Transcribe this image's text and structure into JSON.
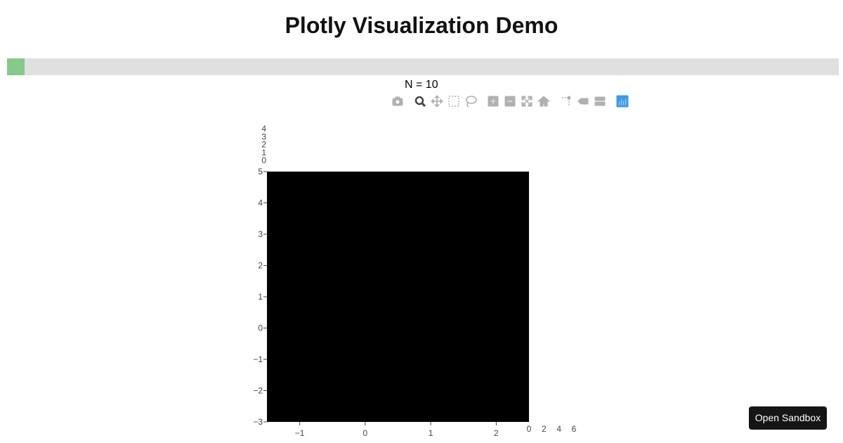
{
  "page": {
    "title": "Plotly Visualization Demo"
  },
  "progress": {
    "fraction": 0.021,
    "color": "#86c988"
  },
  "plot": {
    "n_label": "N = 10"
  },
  "modebar": {
    "buttons": [
      {
        "icon": "camera-icon",
        "active": false
      },
      {
        "icon": "zoom-icon",
        "active": true
      },
      {
        "icon": "pan-icon",
        "active": false
      },
      {
        "icon": "box-select-icon",
        "active": false
      },
      {
        "icon": "lasso-select-icon",
        "active": false
      },
      {
        "icon": "zoom-in-icon",
        "active": false
      },
      {
        "icon": "zoom-out-icon",
        "active": false
      },
      {
        "icon": "autoscale-icon",
        "active": false
      },
      {
        "icon": "reset-axes-icon",
        "active": false
      },
      {
        "icon": "spike-lines-icon",
        "active": false
      },
      {
        "icon": "hover-closest-icon",
        "active": false
      },
      {
        "icon": "hover-compare-icon",
        "active": false
      },
      {
        "icon": "plotly-logo-icon",
        "active": false
      }
    ],
    "colors": {
      "inactive": "#b0b0b0",
      "active": "#444444",
      "logo": "#3d9be9"
    }
  },
  "chart_data": {
    "type": "heatmap",
    "main": {
      "xlim": [
        -1.5,
        2.5
      ],
      "ylim": [
        -3,
        5
      ],
      "xticks": [
        "−1",
        "0",
        "1",
        "2"
      ],
      "xtick_values": [
        -1,
        0,
        1,
        2
      ],
      "yticks": [
        "−3",
        "−2",
        "−1",
        "0",
        "1",
        "2",
        "3",
        "4",
        "5"
      ],
      "ytick_values": [
        -3,
        -2,
        -1,
        0,
        1,
        2,
        3,
        4,
        5
      ],
      "fill_color": "#000000"
    },
    "top_histogram": {
      "yticks": [
        "0",
        "1",
        "2",
        "3",
        "4"
      ],
      "ytick_values": [
        0,
        1,
        2,
        3,
        4
      ],
      "ylim": [
        0,
        4
      ]
    },
    "right_histogram": {
      "xticks": [
        "0",
        "2",
        "4",
        "6"
      ],
      "xtick_values": [
        0,
        2,
        4,
        6
      ],
      "xlim": [
        0,
        6
      ]
    },
    "grid": false
  },
  "sandbox": {
    "label": "Open Sandbox"
  }
}
